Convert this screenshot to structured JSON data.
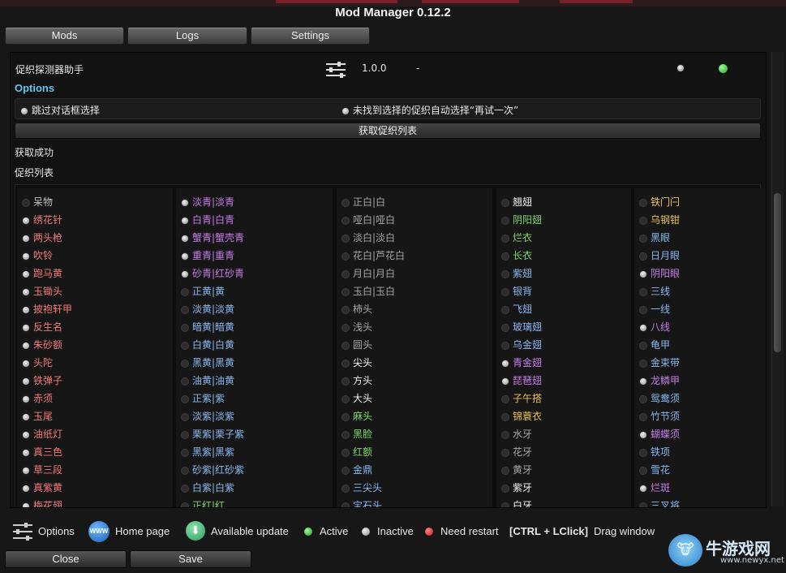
{
  "window": {
    "title": "Mod Manager 0.12.2"
  },
  "tabs": [
    "Mods",
    "Logs",
    "Settings"
  ],
  "mod": {
    "name": "促织探测器助手",
    "version": "1.0.0",
    "dash": "-"
  },
  "options": {
    "label": "Options",
    "items": [
      "跳过对话框选择",
      "未找到选择的促织自动选择“再试一次”"
    ],
    "fetch_button": "获取促织列表",
    "status": "获取成功",
    "list_title": "促织列表"
  },
  "columns": [
    [
      {
        "t": "呆物",
        "c": "#bfbfbf",
        "on": false
      },
      {
        "t": "绣花针",
        "c": "#f07a7a",
        "on": true
      },
      {
        "t": "两头枪",
        "c": "#f07a7a",
        "on": true
      },
      {
        "t": "吹铃",
        "c": "#f07a7a",
        "on": true
      },
      {
        "t": "跑马黄",
        "c": "#f07a7a",
        "on": true
      },
      {
        "t": "玉锄头",
        "c": "#f07a7a",
        "on": true
      },
      {
        "t": "披袍轩甲",
        "c": "#f07a7a",
        "on": true
      },
      {
        "t": "反生名",
        "c": "#f07a7a",
        "on": true
      },
      {
        "t": "朱砂额",
        "c": "#f07a7a",
        "on": true
      },
      {
        "t": "头陀",
        "c": "#f07a7a",
        "on": true
      },
      {
        "t": "铁弹子",
        "c": "#f07a7a",
        "on": true
      },
      {
        "t": "赤须",
        "c": "#f07a7a",
        "on": true
      },
      {
        "t": "玉尾",
        "c": "#f07a7a",
        "on": true
      },
      {
        "t": "油纸灯",
        "c": "#f07a7a",
        "on": true
      },
      {
        "t": "真三色",
        "c": "#f07a7a",
        "on": true
      },
      {
        "t": "草三段",
        "c": "#f07a7a",
        "on": true
      },
      {
        "t": "真紫黄",
        "c": "#f07a7a",
        "on": true
      },
      {
        "t": "梅花翅",
        "c": "#f07a7a",
        "on": true
      }
    ],
    [
      {
        "t": "淡青|淡青",
        "c": "#c77ce8",
        "on": true
      },
      {
        "t": "白青|白青",
        "c": "#c77ce8",
        "on": true
      },
      {
        "t": "蟹青|蟹壳青",
        "c": "#c77ce8",
        "on": true
      },
      {
        "t": "重青|重青",
        "c": "#c77ce8",
        "on": true
      },
      {
        "t": "砂青|红砂青",
        "c": "#c77ce8",
        "on": true
      },
      {
        "t": "正黄|黄",
        "c": "#89b8f0",
        "on": false
      },
      {
        "t": "淡黄|淡黄",
        "c": "#89b8f0",
        "on": false
      },
      {
        "t": "暗黄|暗黄",
        "c": "#89b8f0",
        "on": false
      },
      {
        "t": "白黄|白黄",
        "c": "#89b8f0",
        "on": false
      },
      {
        "t": "黑黄|黑黄",
        "c": "#89b8f0",
        "on": false
      },
      {
        "t": "油黄|油黄",
        "c": "#89b8f0",
        "on": false
      },
      {
        "t": "正紫|紫",
        "c": "#89b8f0",
        "on": false
      },
      {
        "t": "淡紫|淡紫",
        "c": "#89b8f0",
        "on": false
      },
      {
        "t": "栗紫|栗子紫",
        "c": "#89b8f0",
        "on": false
      },
      {
        "t": "黑紫|黑紫",
        "c": "#89b8f0",
        "on": false
      },
      {
        "t": "砂紫|红砂紫",
        "c": "#89b8f0",
        "on": false
      },
      {
        "t": "白紫|白紫",
        "c": "#89b8f0",
        "on": false
      },
      {
        "t": "正红|红",
        "c": "#7fd66a",
        "on": false
      }
    ],
    [
      {
        "t": "正白|白",
        "c": "#a6a6a6",
        "on": false
      },
      {
        "t": "哑白|哑白",
        "c": "#a6a6a6",
        "on": false
      },
      {
        "t": "淡白|淡白",
        "c": "#a6a6a6",
        "on": false
      },
      {
        "t": "花白|芦花白",
        "c": "#a6a6a6",
        "on": false
      },
      {
        "t": "月白|月白",
        "c": "#a6a6a6",
        "on": false
      },
      {
        "t": "玉白|玉白",
        "c": "#a6a6a6",
        "on": false
      },
      {
        "t": "柿头",
        "c": "#a6a6a6",
        "on": false
      },
      {
        "t": "浅头",
        "c": "#a6a6a6",
        "on": false
      },
      {
        "t": "圆头",
        "c": "#a6a6a6",
        "on": false
      },
      {
        "t": "尖头",
        "c": "#f2f2f2",
        "on": false
      },
      {
        "t": "方头",
        "c": "#f2f2f2",
        "on": false
      },
      {
        "t": "大头",
        "c": "#f2f2f2",
        "on": false
      },
      {
        "t": "麻头",
        "c": "#7fd66a",
        "on": false
      },
      {
        "t": "黑脸",
        "c": "#7fd66a",
        "on": false
      },
      {
        "t": "红额",
        "c": "#7fd66a",
        "on": false
      },
      {
        "t": "金鼎",
        "c": "#89b8f0",
        "on": false
      },
      {
        "t": "三尖头",
        "c": "#89b8f0",
        "on": false
      },
      {
        "t": "宝石头",
        "c": "#89b8f0",
        "on": false
      }
    ],
    [
      {
        "t": "翘翅",
        "c": "#f2f2f2",
        "on": false
      },
      {
        "t": "阴阳翅",
        "c": "#7fd66a",
        "on": false
      },
      {
        "t": "烂衣",
        "c": "#7fd66a",
        "on": false
      },
      {
        "t": "长衣",
        "c": "#7fd66a",
        "on": false
      },
      {
        "t": "紫翅",
        "c": "#89b8f0",
        "on": false
      },
      {
        "t": "银背",
        "c": "#89b8f0",
        "on": false
      },
      {
        "t": "飞翅",
        "c": "#89b8f0",
        "on": false
      },
      {
        "t": "玻璃翅",
        "c": "#89b8f0",
        "on": false
      },
      {
        "t": "乌金翅",
        "c": "#89b8f0",
        "on": false
      },
      {
        "t": "青金翅",
        "c": "#c77ce8",
        "on": true
      },
      {
        "t": "琵琶翅",
        "c": "#c77ce8",
        "on": true
      },
      {
        "t": "子午搭",
        "c": "#e8c35a",
        "on": false
      },
      {
        "t": "锦蓑衣",
        "c": "#e8c35a",
        "on": false
      },
      {
        "t": "水牙",
        "c": "#a6a6a6",
        "on": false
      },
      {
        "t": "花牙",
        "c": "#a6a6a6",
        "on": false
      },
      {
        "t": "黄牙",
        "c": "#a6a6a6",
        "on": false
      },
      {
        "t": "紫牙",
        "c": "#f2f2f2",
        "on": false
      },
      {
        "t": "白牙",
        "c": "#f2f2f2",
        "on": false
      }
    ],
    [
      {
        "t": "铁门闩",
        "c": "#e8c35a",
        "on": false
      },
      {
        "t": "乌钢钳",
        "c": "#e8c35a",
        "on": false
      },
      {
        "t": "黑眼",
        "c": "#89b8f0",
        "on": false
      },
      {
        "t": "日月眼",
        "c": "#89b8f0",
        "on": false
      },
      {
        "t": "阴阳眼",
        "c": "#c77ce8",
        "on": true
      },
      {
        "t": "三线",
        "c": "#89b8f0",
        "on": false
      },
      {
        "t": "一线",
        "c": "#89b8f0",
        "on": false
      },
      {
        "t": "八线",
        "c": "#c77ce8",
        "on": true
      },
      {
        "t": "龟甲",
        "c": "#89b8f0",
        "on": false
      },
      {
        "t": "金束带",
        "c": "#89b8f0",
        "on": false
      },
      {
        "t": "龙鳞甲",
        "c": "#c77ce8",
        "on": true
      },
      {
        "t": "鸳鸯须",
        "c": "#89b8f0",
        "on": false
      },
      {
        "t": "竹节须",
        "c": "#89b8f0",
        "on": false
      },
      {
        "t": "蝴蝶须",
        "c": "#c77ce8",
        "on": true
      },
      {
        "t": "铁项",
        "c": "#89b8f0",
        "on": false
      },
      {
        "t": "雪花",
        "c": "#89b8f0",
        "on": false
      },
      {
        "t": "烂斑",
        "c": "#c77ce8",
        "on": true
      },
      {
        "t": "三叉将",
        "c": "#89b8f0",
        "on": false
      }
    ]
  ],
  "footer": {
    "options": "Options",
    "www_badge": "WWW",
    "home_page": "Home page",
    "available_update": "Available update",
    "active": "Active",
    "inactive": "Inactive",
    "need_restart": "Need restart",
    "drag_keys": "[CTRL + LClick]",
    "drag_window": "Drag window",
    "close": "Close",
    "save": "Save"
  },
  "watermark": {
    "name": "牛游戏网",
    "url": "www.newyx.net"
  },
  "colors": {
    "accent": "#5ec8ef",
    "active": "#1fa51f",
    "inactive": "#9a9a9a",
    "need_restart": "#d11c1c"
  }
}
